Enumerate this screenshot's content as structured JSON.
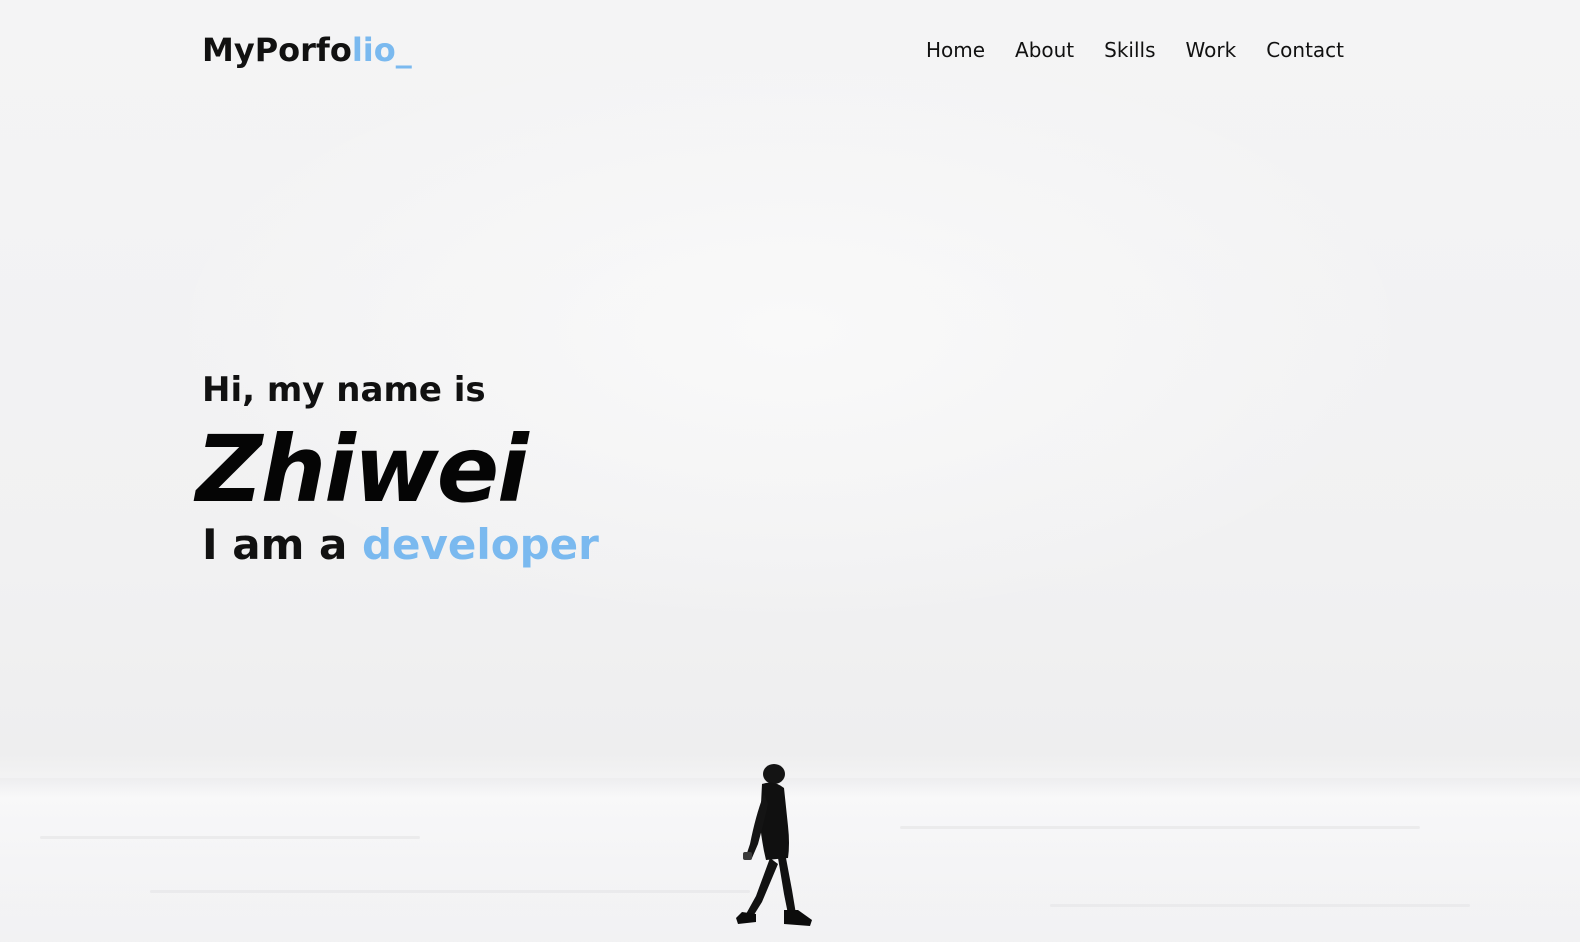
{
  "header": {
    "logo_main": "MyPorfo",
    "logo_accent": "lio_",
    "nav": [
      {
        "label": "Home"
      },
      {
        "label": "About"
      },
      {
        "label": "Skills"
      },
      {
        "label": "Work"
      },
      {
        "label": "Contact"
      }
    ]
  },
  "hero": {
    "greeting": "Hi, my name is",
    "name": "Zhiwei",
    "role_prefix": "I am a",
    "role_highlight": "developer"
  },
  "colors": {
    "accent": "#7ab9ef",
    "text": "#111111",
    "background": "#f3f3f4"
  }
}
